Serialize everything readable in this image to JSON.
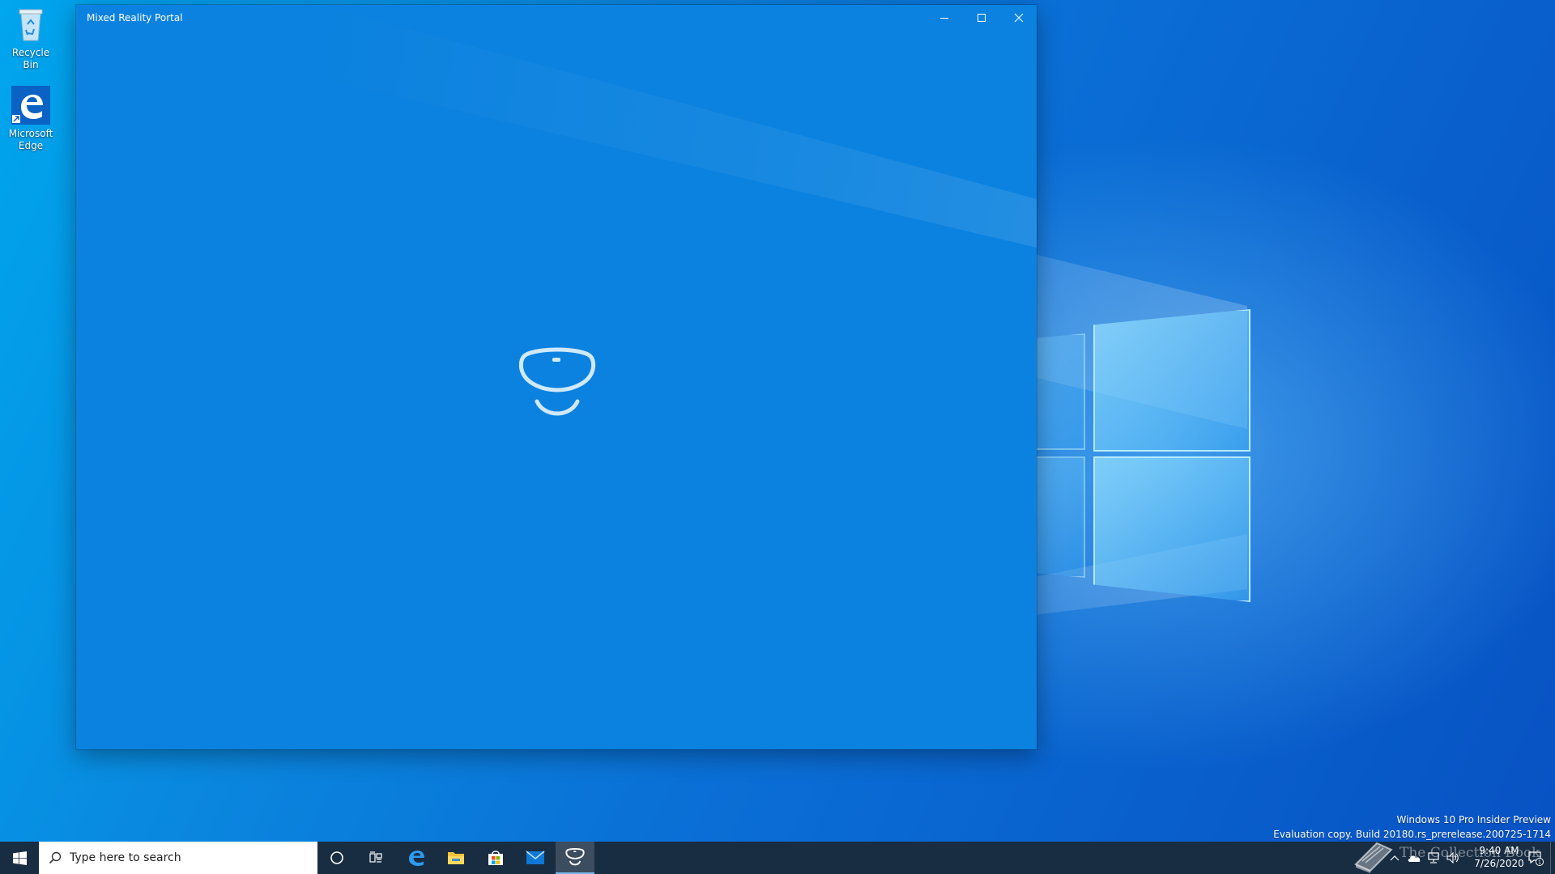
{
  "desktop": {
    "icons": [
      {
        "label": "Recycle Bin",
        "icon": "recycle-bin-icon"
      },
      {
        "label": "Microsoft Edge",
        "icon": "edge-icon"
      }
    ]
  },
  "app_window": {
    "title": "Mixed Reality Portal",
    "controls": [
      "minimize-icon",
      "maximize-icon",
      "close-icon"
    ],
    "splash_icon": "mixed-reality-headset-icon",
    "background_color": "#0b82df"
  },
  "watermark": {
    "line1": "Windows 10 Pro Insider Preview",
    "line2": "Evaluation copy. Build 20180.rs_prerelease.200725-1714"
  },
  "overlay": {
    "text": "The Collection Book"
  },
  "taskbar": {
    "search_placeholder": "Type here to search",
    "pinned": [
      "edge-icon",
      "file-explorer-icon",
      "store-icon",
      "mail-icon",
      "mixed-reality-portal-icon"
    ],
    "clock_time": "9:40 AM",
    "clock_date": "7/26/2020",
    "notification_count": "1",
    "accent_color": "#76b9ed",
    "background_color": "#061c34"
  }
}
